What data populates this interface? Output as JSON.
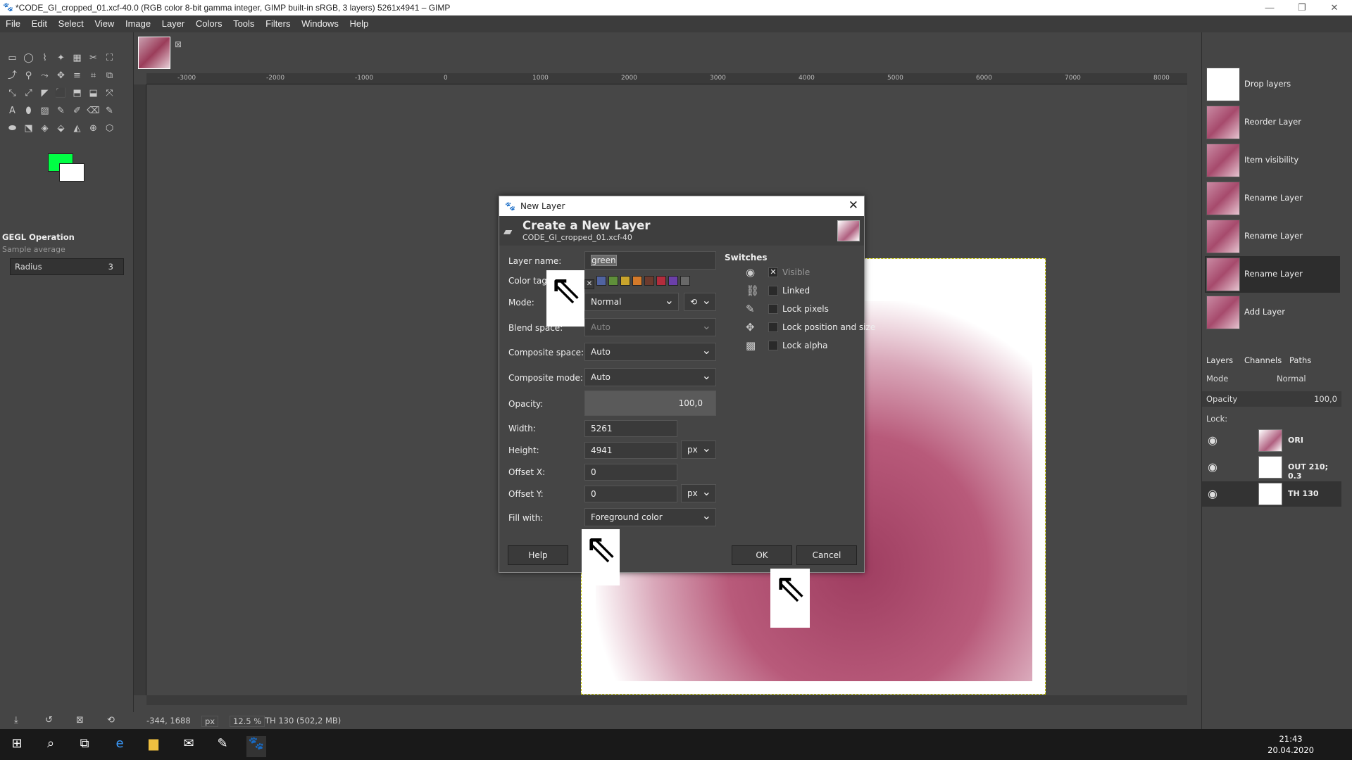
{
  "title": "*CODE_GI_cropped_01.xcf-40.0 (RGB color 8-bit gamma integer, GIMP built-in sRGB, 3 layers) 5261x4941 – GIMP",
  "menu": [
    "File",
    "Edit",
    "Select",
    "View",
    "Image",
    "Layer",
    "Colors",
    "Tools",
    "Filters",
    "Windows",
    "Help"
  ],
  "toolbox": {
    "tools": [
      "▭",
      "◯",
      "⌇",
      "✦",
      "▦",
      "✂",
      "⛶",
      "⤴",
      "⚲",
      "⤳",
      "✥",
      "≡",
      "⌗",
      "⧉",
      "⤡",
      "⤢",
      "◤",
      "⬛",
      "⬒",
      "⬓",
      "⤧",
      "A",
      "⬮",
      "▨",
      "✎",
      "✐",
      "⌫",
      "✎",
      "⬬",
      "⬔",
      "◈",
      "⬙",
      "◭",
      "⊕",
      "⬡"
    ],
    "fg_color": "#00ff44",
    "bg_color": "#ffffff",
    "gegl_title": "GEGL Operation",
    "gegl_sub": "Sample average",
    "radius_label": "Radius",
    "radius_value": "3"
  },
  "ruler_labels": [
    "-3000",
    "-2000",
    "-1000",
    "0",
    "1000",
    "2000",
    "3000",
    "4000",
    "5000",
    "6000",
    "7000",
    "8000"
  ],
  "status": {
    "coords": "-344, 1688",
    "unit": "px",
    "zoom": "12.5 %",
    "info": "TH 130 (502,2 MB)"
  },
  "undo": [
    "Drop layers",
    "Reorder Layer",
    "Item visibility",
    "Rename Layer",
    "Rename Layer",
    "Rename Layer",
    "Add Layer"
  ],
  "layers_panel": {
    "tabs": [
      "Layers",
      "Channels",
      "Paths"
    ],
    "mode_label": "Mode",
    "mode_value": "Normal",
    "opacity_label": "Opacity",
    "opacity_value": "100,0",
    "lock_label": "Lock:",
    "layers": [
      "ORI",
      "OUT 210; 0.3",
      "TH 130"
    ]
  },
  "dialog": {
    "window_title": "New Layer",
    "heading": "Create a New Layer",
    "subheading": "CODE_GI_cropped_01.xcf-40",
    "layer_name_label": "Layer name:",
    "layer_name_value": "green",
    "color_tag_label": "Color tag",
    "color_tags": [
      "#5063a0",
      "#5f8f3a",
      "#c9a42c",
      "#d47a2a",
      "#6b3a2e",
      "#b32c3c",
      "#6b3fa8",
      "#686868"
    ],
    "mode_label": "Mode:",
    "mode_value": "Normal",
    "blend_label": "Blend space:",
    "blend_value": "Auto",
    "composite_space_label": "Composite space:",
    "composite_space_value": "Auto",
    "composite_mode_label": "Composite mode:",
    "composite_mode_value": "Auto",
    "opacity_label": "Opacity:",
    "opacity_value": "100,0",
    "width_label": "Width:",
    "width_value": "5261",
    "height_label": "Height:",
    "height_value": "4941",
    "unit": "px",
    "offx_label": "Offset X:",
    "offx_value": "0",
    "offy_label": "Offset Y:",
    "offy_value": "0",
    "fill_label": "Fill with:",
    "fill_value": "Foreground color",
    "switches_title": "Switches",
    "switches": [
      "Visible",
      "Linked",
      "Lock pixels",
      "Lock position and size",
      "Lock alpha"
    ],
    "help": "Help",
    "ok": "OK",
    "cancel": "Cancel"
  },
  "taskbar": {
    "time": "21:43",
    "date": "20.04.2020"
  }
}
